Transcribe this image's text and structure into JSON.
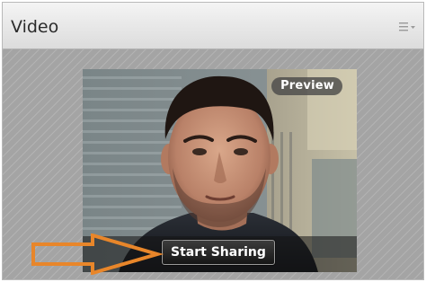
{
  "pod": {
    "title": "Video",
    "menu_icon": "hamburger-menu-icon"
  },
  "video": {
    "preview_label": "Preview",
    "start_sharing_label": "Start Sharing"
  },
  "annotation": {
    "arrow_color": "#e8862a",
    "arrow_icon": "right-arrow-outline-icon"
  },
  "colors": {
    "header_top": "#f4f4f4",
    "header_bottom": "#dcdcdc",
    "body_background": "#a4a4a4"
  }
}
